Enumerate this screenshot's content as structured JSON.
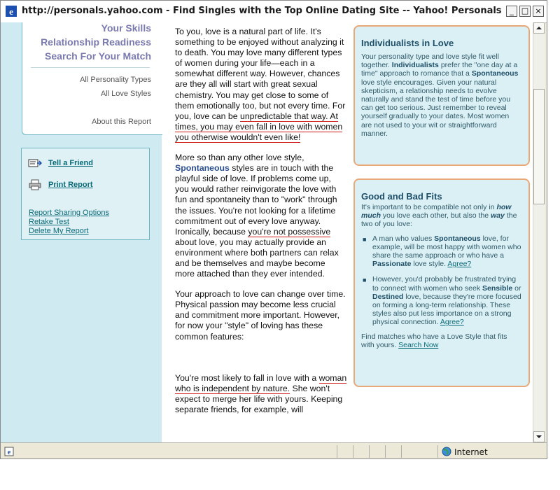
{
  "window": {
    "title": "http://personals.yahoo.com - Find Singles with the Top Online Dating Site -- Yahoo! Personals - Microsoft Inte...",
    "minimize": "_",
    "maximize": "□",
    "close": "×"
  },
  "sidebar": {
    "skills": "Your Skills",
    "readiness": "Relationship Readiness",
    "search_match": "Search For Your Match",
    "all_personality": "All Personality Types",
    "all_love": "All Love Styles",
    "about": "About this Report",
    "tell_friend": "Tell a Friend",
    "print_report": "Print Report",
    "sharing_options": "Report Sharing Options",
    "retake": "Retake Test",
    "delete": "Delete My Report"
  },
  "main": {
    "p1_a": "To you, love is a natural part of life. It's something to be enjoyed without analyzing it to death. You may love many different types of women during your life—each in a somewhat different way. However, chances are they all will start with great sexual chemistry. You may get close to some of them emotionally too, but not every time. For you, love can be ",
    "p1_hl": "unpredictable that way. At times, you may even fall in love with women you otherwise wouldn't even like!",
    "p2_a": "More so than any other love style, ",
    "p2_style": "Spontaneous",
    "p2_b": " styles are in touch with the playful side of love. If problems come up, you would rather reinvigorate the love with fun and spontaneity than to \"work\" through the issues. You're not looking for a lifetime commitment out of every love anyway. Ironically, because ",
    "p2_hl": "you're not possessive",
    "p2_c": " about love, you may actually provide an environment where both partners can relax and be themselves and maybe become more attached than they ever intended.",
    "p3": "Your approach to love can change over time. Physical passion may become less crucial and commitment more important. However, for now your \"style\" of loving has these common features:",
    "p4_a": "You're most likely to fall in love with a ",
    "p4_hl": "woman who is independent by nature.",
    "p4_b": " She won't expect to merge her life with yours. Keeping separate friends, for example, will"
  },
  "card1": {
    "title": "Individualists in Love",
    "t1": "Your personality type and love style fit well together. ",
    "b1": "Individualists",
    "t2": " prefer the \"one day at a time\" approach to romance that a ",
    "b2": "Spontaneous",
    "t3": " love style encourages. Given your natural skepticism, a relationship needs to evolve naturally and stand the test of time before you can get too serious. Just remember to reveal yourself gradually to your dates. Most women are not used to your wit or straightforward manner."
  },
  "card2": {
    "title": "Good and Bad Fits",
    "intro_a": "It's important to be compatible not only in ",
    "intro_b": "how much",
    "intro_c": " you love each other, but also the ",
    "intro_d": "way",
    "intro_e": " the two of you love:",
    "bullet1_a": "A man who values ",
    "bullet1_b": "Spontaneous",
    "bullet1_c": " love, for example, will be most happy with women who share the same approach or who have a ",
    "bullet1_d": "Passionate",
    "bullet1_e": " love style. ",
    "agree": "Agree?",
    "bullet2_a": "However, you'd probably be frustrated trying to connect with women who seek ",
    "bullet2_b": "Sensible",
    "bullet2_c": " or ",
    "bullet2_d": "Destined",
    "bullet2_e": " love, because they're more focused on forming a long-term relationship. These styles also put less importance on a strong physical connection. ",
    "footer_a": "Find matches who have a Love Style that fits with yours. ",
    "footer_link": "Search Now"
  },
  "status": {
    "zone": "Internet"
  },
  "colors": {
    "sidebar_bg": "#cfeaf0",
    "card_border": "#e8a878",
    "card_bg": "#daf0f4",
    "highlight_underline": "#d21d1d",
    "link": "#0b6a78"
  },
  "icons": [
    "ie-logo-icon",
    "tell-friend-icon",
    "print-icon",
    "page-icon",
    "globe-icon"
  ]
}
